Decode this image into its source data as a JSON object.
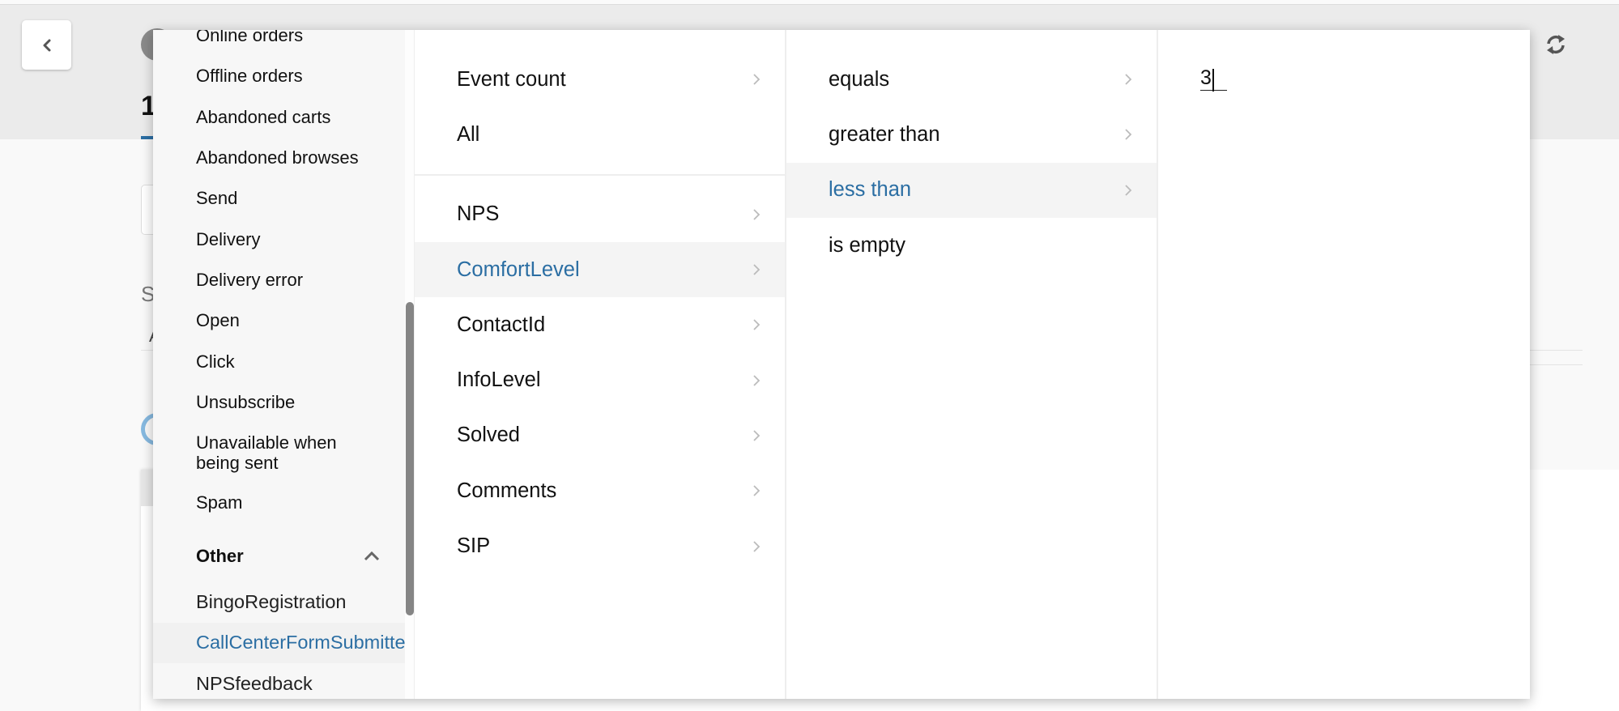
{
  "background": {
    "heading_fragment": "1",
    "label_fragment": "S",
    "label2_fragment": "A"
  },
  "column_events": {
    "items": [
      {
        "label": "Online orders",
        "kind": "item"
      },
      {
        "label": "Offline orders",
        "kind": "item"
      },
      {
        "label": "Abandoned carts",
        "kind": "item"
      },
      {
        "label": "Abandoned browses",
        "kind": "item"
      },
      {
        "label": "Send",
        "kind": "item"
      },
      {
        "label": "Delivery",
        "kind": "item"
      },
      {
        "label": "Delivery error",
        "kind": "item"
      },
      {
        "label": "Open",
        "kind": "item"
      },
      {
        "label": "Click",
        "kind": "item"
      },
      {
        "label": "Unsubscribe",
        "kind": "item"
      },
      {
        "label": "Unavailable when being sent",
        "kind": "multiline"
      },
      {
        "label": "Spam",
        "kind": "item"
      }
    ],
    "group": {
      "label": "Other",
      "expanded": true
    },
    "group_items": [
      {
        "label": "BingoRegistration",
        "selected": false
      },
      {
        "label": "CallCenterFormSubmitted",
        "selected": true
      },
      {
        "label": "NPSfeedback",
        "selected": false
      }
    ]
  },
  "column_fields": {
    "top_items": [
      {
        "label": "Event count",
        "has_submenu": true
      },
      {
        "label": "All",
        "has_submenu": false
      }
    ],
    "items": [
      {
        "label": "NPS",
        "selected": false
      },
      {
        "label": "ComfortLevel",
        "selected": true
      },
      {
        "label": "ContactId",
        "selected": false
      },
      {
        "label": "InfoLevel",
        "selected": false
      },
      {
        "label": "Solved",
        "selected": false
      },
      {
        "label": "Comments",
        "selected": false
      },
      {
        "label": "SIP",
        "selected": false
      }
    ]
  },
  "column_operators": {
    "items": [
      {
        "label": "equals",
        "selected": false
      },
      {
        "label": "greater than",
        "selected": false
      },
      {
        "label": "less than",
        "selected": true
      },
      {
        "label": "is empty",
        "selected": false
      }
    ]
  },
  "column_value": {
    "input_value": "3"
  },
  "icons": {
    "back": "chevron-left-icon",
    "refresh": "refresh-icon",
    "group_toggle": "chevron-up-icon",
    "submenu": "chevron-right-icon"
  },
  "colors": {
    "accent": "#2b6ea3",
    "selected_bg": "#f4f4f4",
    "header_bg": "#ebebeb"
  }
}
